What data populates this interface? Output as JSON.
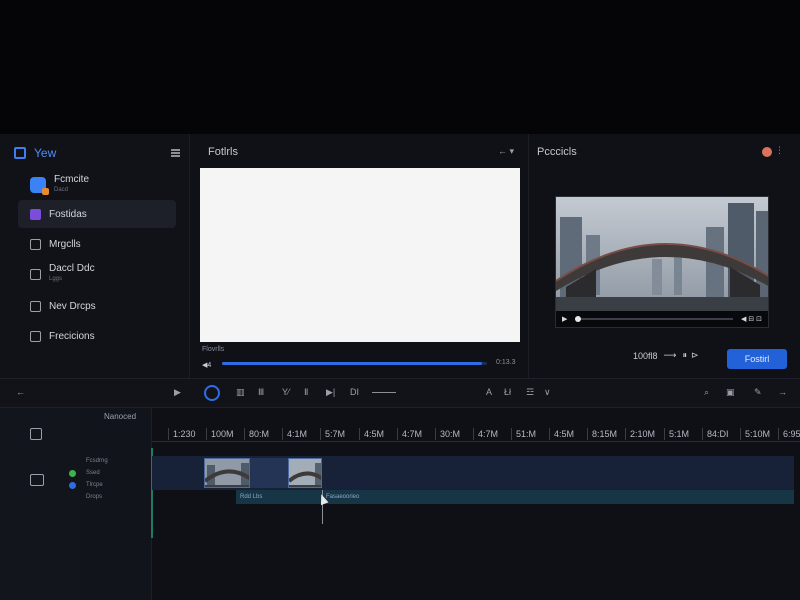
{
  "sidebar": {
    "title": "Yew",
    "items": [
      {
        "label": "Fcmcite",
        "sub": "Dacd",
        "icon": "app-icon"
      },
      {
        "label": "Fostidas",
        "sub": "",
        "icon": "checkbox-icon"
      },
      {
        "label": "Mrgclls",
        "sub": "",
        "icon": "calendar-icon"
      },
      {
        "label": "Daccl Ddc",
        "sub": "Lggs",
        "icon": "folder-icon"
      },
      {
        "label": "Nev Drcps",
        "sub": "",
        "icon": "shape-icon"
      },
      {
        "label": "Frecicions",
        "sub": "",
        "icon": "media-icon"
      }
    ]
  },
  "preview": {
    "title": "Fotlrls",
    "controls": "← ▾",
    "caption": "Flovrlls",
    "mini_label": "◀4",
    "progress": 0.98,
    "percent_label": "0:13.3"
  },
  "right_panel": {
    "title": "Pcccicls",
    "more": "⋮",
    "video_time_left": "▶",
    "video_time_right": "◀ ⊟ ⊡",
    "playback_position": 0.0,
    "zoom_label": "100fl8",
    "export_label": "Fostirl"
  },
  "toolbar": {
    "back": "←",
    "play": "▶",
    "tools": [
      "▥",
      "Ⅲ",
      "Y⁄",
      "Ⅱ",
      "▶|",
      "DI"
    ],
    "right_tools": [
      "A",
      "Łł",
      "☲",
      "∨"
    ],
    "far_right": [
      "⌕",
      "▣",
      "✎",
      "→"
    ]
  },
  "timeline": {
    "header": "Nanoced",
    "tracks": [
      "Fcsdrng",
      "Ssed",
      "Tlrcpe",
      "Drops"
    ],
    "ticks": [
      "1:230",
      "100M",
      "80:M",
      "4:1M",
      "5:7M",
      "4:5M",
      "4:7M",
      "30:M",
      "4:7M",
      "51:M",
      "4:5M",
      "8:15M",
      "2:10M",
      "5:1M",
      "84:DI",
      "5:10M",
      "6:95"
    ],
    "clip_label_1": "Rdd Lbs",
    "clip_label_2": "Fasaeoorieo"
  },
  "colors": {
    "accent": "#2f6de6",
    "background": "#0f1117",
    "timeline_clip": "#172238"
  }
}
